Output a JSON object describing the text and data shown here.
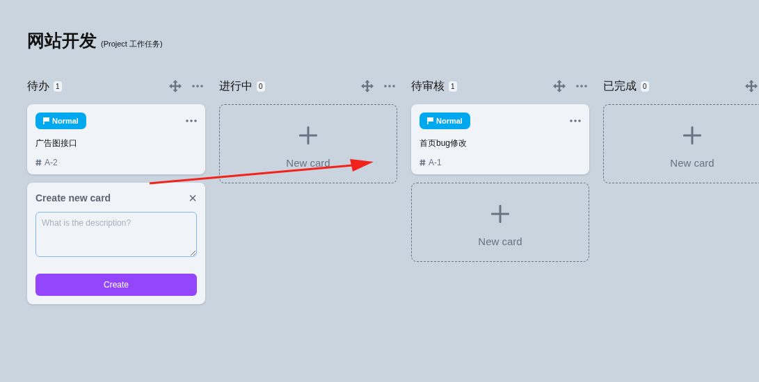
{
  "board": {
    "title": "网站开发",
    "subtitle": "(Project 工作任务)"
  },
  "columns": [
    {
      "title": "待办",
      "count": "1",
      "cards": [
        {
          "priority": "Normal",
          "title": "广告图接口",
          "id": "A-2"
        }
      ],
      "footer": {
        "kind": "form",
        "heading": "Create new card",
        "close": "×",
        "placeholder": "What is the description?",
        "button": "Create"
      }
    },
    {
      "title": "进行中",
      "count": "0",
      "footer": {
        "kind": "new_card",
        "label": "New card"
      }
    },
    {
      "title": "待审核",
      "count": "1",
      "cards": [
        {
          "priority": "Normal",
          "title": "首页bug修改",
          "id": "A-1"
        }
      ],
      "footer": {
        "kind": "new_card",
        "label": "New card"
      }
    },
    {
      "title": "已完成",
      "count": "0",
      "footer": {
        "kind": "new_card",
        "label": "New card"
      }
    }
  ]
}
